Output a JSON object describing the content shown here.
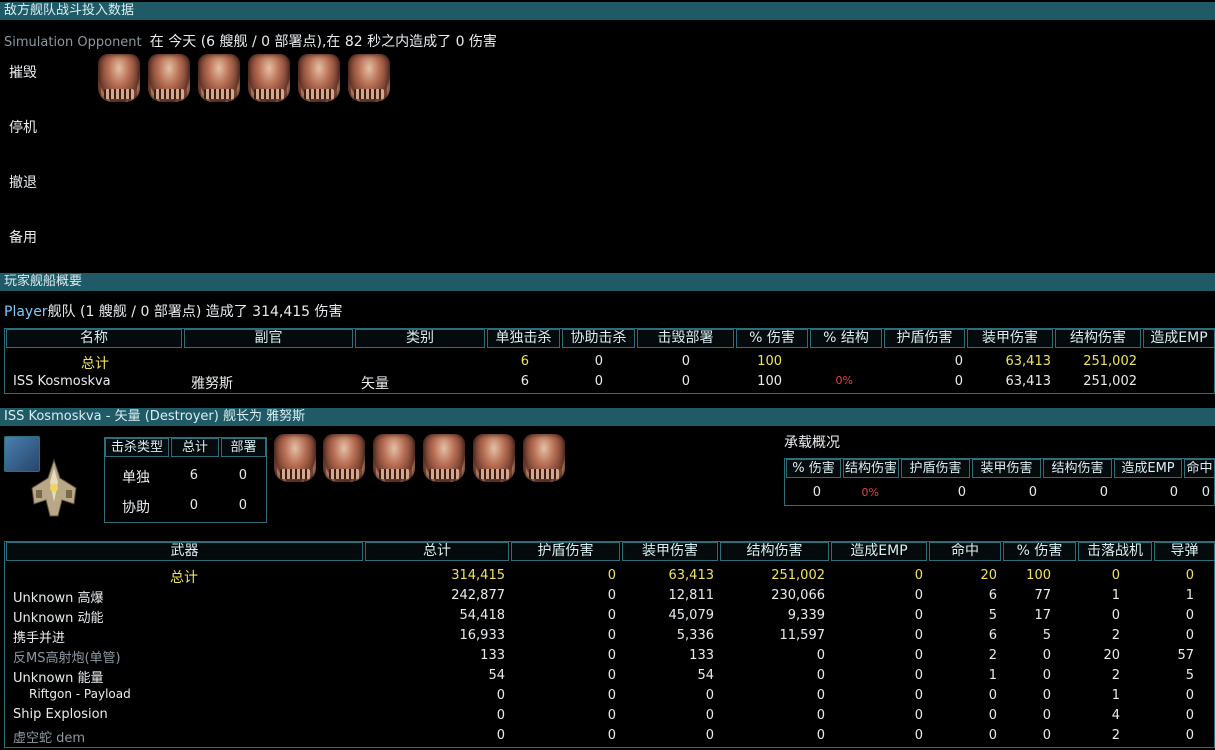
{
  "enemy_section": {
    "title": "敌方舰队战斗投入数据",
    "opponent_name": "Simulation Opponent",
    "summary": "在 今天 (6 艘舰 / 0 部署点),在 82 秒之内造成了 0 伤害",
    "rows": [
      "摧毁",
      "停机",
      "撤退",
      "备用"
    ]
  },
  "player_section": {
    "title": "玩家舰船概要",
    "player_label": "Player",
    "summary": "舰队 (1 艘舰 / 0 部署点) 造成了 314,415 伤害",
    "headers": [
      "名称",
      "副官",
      "类别",
      "单独击杀",
      "协助击杀",
      "击毁部署",
      "% 伤害",
      "% 结构",
      "护盾伤害",
      "装甲伤害",
      "结构伤害",
      "造成EMP"
    ],
    "total": {
      "name": "总计",
      "solo": "6",
      "assist": "0",
      "dp": "0",
      "pct_dmg": "100",
      "shield": "0",
      "armor": "63,413",
      "hull": "251,002"
    },
    "ship_row": {
      "name": "ISS Kosmoskva",
      "officer": "雅努斯",
      "class": "矢量",
      "solo": "6",
      "assist": "0",
      "dp": "0",
      "pct_dmg": "100",
      "pct_hull": "0%",
      "shield": "0",
      "armor": "63,413",
      "hull": "251,002"
    }
  },
  "ship_section": {
    "title": "ISS Kosmoskva - 矢量 (Destroyer) 舰长为 雅努斯",
    "kill_headers": [
      "击杀类型",
      "总计",
      "部署"
    ],
    "kill_rows": [
      {
        "type": "单独",
        "total": "6",
        "dp": "0"
      },
      {
        "type": "协助",
        "total": "0",
        "dp": "0"
      }
    ],
    "carrier_title": "承载概况",
    "carrier_headers": [
      "% 伤害",
      "结构伤害",
      "护盾伤害",
      "装甲伤害",
      "结构伤害",
      "造成EMP",
      "命中"
    ],
    "carrier_values": [
      "0",
      "0%",
      "0",
      "0",
      "0",
      "0",
      "0"
    ]
  },
  "weapons": {
    "headers": [
      "武器",
      "总计",
      "护盾伤害",
      "装甲伤害",
      "结构伤害",
      "造成EMP",
      "命中",
      "% 伤害",
      "击落战机",
      "导弹"
    ],
    "total": {
      "name": "总计",
      "total": "314,415",
      "shield": "0",
      "armor": "63,413",
      "hull": "251,002",
      "emp": "0",
      "hits": "20",
      "pct": "100",
      "fighters": "0",
      "missiles": "0"
    },
    "rows": [
      {
        "name": "Unknown 高爆",
        "total": "242,877",
        "shield": "0",
        "armor": "12,811",
        "hull": "230,066",
        "emp": "0",
        "hits": "6",
        "pct": "77",
        "fighters": "1",
        "missiles": "1"
      },
      {
        "name": "Unknown 动能",
        "total": "54,418",
        "shield": "0",
        "armor": "45,079",
        "hull": "9,339",
        "emp": "0",
        "hits": "5",
        "pct": "17",
        "fighters": "0",
        "missiles": "0"
      },
      {
        "name": "携手并进",
        "total": "16,933",
        "shield": "0",
        "armor": "5,336",
        "hull": "11,597",
        "emp": "0",
        "hits": "6",
        "pct": "5",
        "fighters": "2",
        "missiles": "0"
      },
      {
        "name": "反MS高射炮(单管)",
        "total": "133",
        "shield": "0",
        "armor": "133",
        "hull": "0",
        "emp": "0",
        "hits": "2",
        "pct": "0",
        "fighters": "20",
        "missiles": "57"
      },
      {
        "name": "Unknown 能量",
        "total": "54",
        "shield": "0",
        "armor": "54",
        "hull": "0",
        "emp": "0",
        "hits": "1",
        "pct": "0",
        "fighters": "2",
        "missiles": "5"
      },
      {
        "name": "Riftgon - Payload",
        "total": "0",
        "shield": "0",
        "armor": "0",
        "hull": "0",
        "emp": "0",
        "hits": "0",
        "pct": "0",
        "fighters": "1",
        "missiles": "0"
      },
      {
        "name": "Ship Explosion",
        "total": "0",
        "shield": "0",
        "armor": "0",
        "hull": "0",
        "emp": "0",
        "hits": "0",
        "pct": "0",
        "fighters": "4",
        "missiles": "0"
      },
      {
        "name": "虚空蛇 dem",
        "total": "0",
        "shield": "0",
        "armor": "0",
        "hull": "0",
        "emp": "0",
        "hits": "0",
        "pct": "0",
        "fighters": "2",
        "missiles": "0"
      }
    ]
  }
}
